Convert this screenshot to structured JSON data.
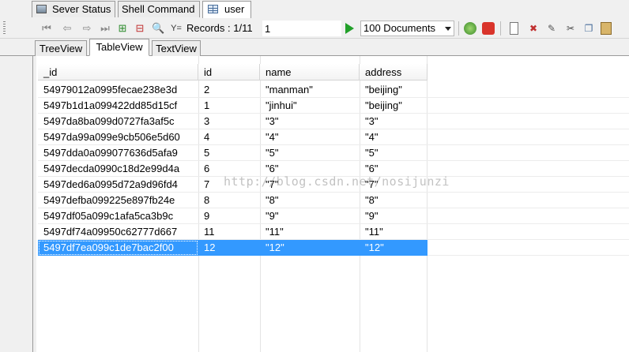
{
  "document_tabs": [
    {
      "label": "Sever Status",
      "icon": "server-icon"
    },
    {
      "label": "Shell Command",
      "icon": ""
    },
    {
      "label": "user",
      "icon": "grid-icon"
    }
  ],
  "toolbar": {
    "records_label": "Records : 1/11",
    "page_value": "1",
    "documents_select": "100  Documents"
  },
  "view_tabs": [
    "TreeView",
    "TableView",
    "TextView"
  ],
  "active_view": "TableView",
  "table": {
    "columns": [
      "_id",
      "id",
      "name",
      "address"
    ],
    "rows": [
      [
        "54979012a0995fecae238e3d",
        "2",
        "\"manman\"",
        "\"beijing\""
      ],
      [
        "5497b1d1a099422dd85d15cf",
        "1",
        "\"jinhui\"",
        "\"beijing\""
      ],
      [
        "5497da8ba099d0727fa3af5c",
        "3",
        "\"3\"",
        "\"3\""
      ],
      [
        "5497da99a099e9cb506e5d60",
        "4",
        "\"4\"",
        "\"4\""
      ],
      [
        "5497dda0a099077636d5afa9",
        "5",
        "\"5\"",
        "\"5\""
      ],
      [
        "5497decda0990c18d2e99d4a",
        "6",
        "\"6\"",
        "\"6\""
      ],
      [
        "5497ded6a0995d72a9d96fd4",
        "7",
        "\"7\"",
        "\"7\""
      ],
      [
        "5497defba099225e897fb24e",
        "8",
        "\"8\"",
        "\"8\""
      ],
      [
        "5497df05a099c1afa5ca3b9c",
        "9",
        "\"9\"",
        "\"9\""
      ],
      [
        "5497df74a09950c62777d667",
        "11",
        "\"11\"",
        "\"11\""
      ],
      [
        "5497df7ea099c1de7bac2f00",
        "12",
        "\"12\"",
        "\"12\""
      ]
    ],
    "selected_row": 10
  },
  "watermark": "http://blog.csdn.net/nosijunzi",
  "colors": {
    "selection": "#3399ff",
    "run_button": "#22a02a"
  }
}
